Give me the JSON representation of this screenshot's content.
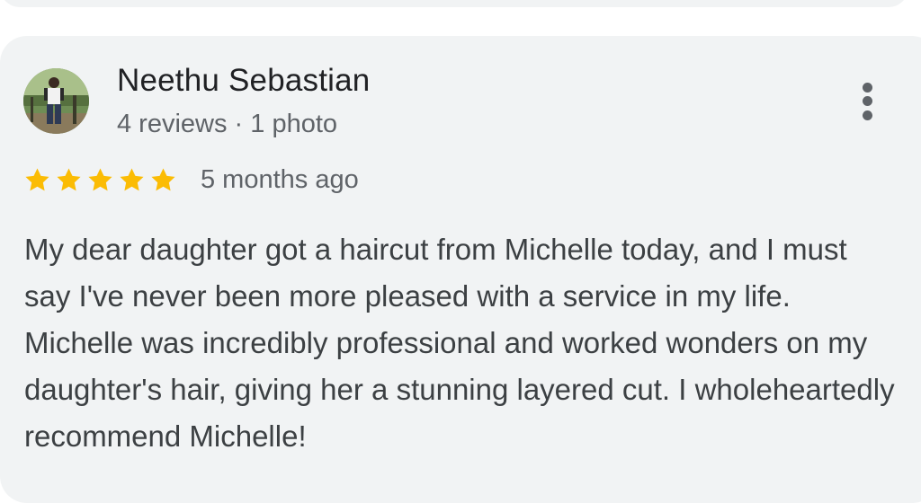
{
  "review": {
    "author_name": "Neethu Sebastian",
    "author_meta": "4 reviews · 1 photo",
    "rating": 5,
    "rating_max": 5,
    "date": "5 months ago",
    "text": "My dear daughter got a haircut from Michelle today, and I must say I've never been more pleased with a service in my life. Michelle was incredibly professional and worked wonders on my daughter's hair, giving her a stunning layered cut. I wholeheartedly recommend Michelle!",
    "icons": {
      "avatar": "user-photo-avatar",
      "menu": "more-vert-icon",
      "star": "star-icon"
    }
  },
  "colors": {
    "card_background": "#f1f3f4",
    "star": "#fbbc04",
    "primary_text": "#202124",
    "secondary_text": "#5f6368",
    "body_text": "#3c4043"
  }
}
